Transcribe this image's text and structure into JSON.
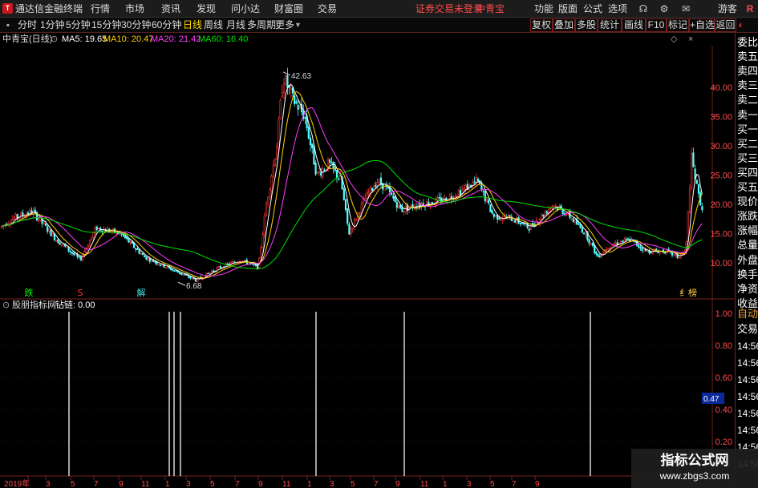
{
  "titlebar": {
    "app_title": "通达信金融终端",
    "menus": [
      "行情",
      "市场",
      "资讯",
      "发现",
      "问小达",
      "财富圈",
      "交易"
    ],
    "status_notice": "证券交易未登录",
    "stock_name": "中青宝",
    "right_menus": [
      "功能",
      "版面",
      "公式",
      "选项"
    ],
    "user": "游客"
  },
  "periodbar": {
    "periods": [
      "分时",
      "1分钟",
      "5分钟",
      "15分钟",
      "30分钟",
      "60分钟",
      "日线",
      "周线",
      "月线",
      "多周期",
      "更多"
    ],
    "active_period": "日线",
    "tools": [
      "复权",
      "叠加",
      "多股",
      "统计",
      "画线",
      "F10",
      "标记",
      "+自选",
      "返回"
    ]
  },
  "chart_info": {
    "title": "中青宝(日线)",
    "ma": [
      {
        "label": "MA5: 19.65",
        "color": "#ffffff"
      },
      {
        "label": "MA10: 20.47",
        "color": "#ffd200"
      },
      {
        "label": "MA20: 21.42",
        "color": "#ff3cff"
      },
      {
        "label": "MA60: 16.40",
        "color": "#00e000"
      }
    ]
  },
  "sidebar": {
    "items": [
      {
        "label": "委比",
        "color": "#ffffff"
      },
      {
        "label": "卖五",
        "color": "#ffffff"
      },
      {
        "label": "卖四",
        "color": "#ffffff"
      },
      {
        "label": "卖三",
        "color": "#ffffff"
      },
      {
        "label": "卖二",
        "color": "#ffffff"
      },
      {
        "label": "卖一",
        "color": "#ffffff"
      },
      {
        "label": "买一",
        "color": "#ffffff"
      },
      {
        "label": "买二",
        "color": "#ffffff"
      },
      {
        "label": "买三",
        "color": "#ffffff"
      },
      {
        "label": "买四",
        "color": "#ffffff"
      },
      {
        "label": "买五",
        "color": "#ffffff"
      },
      {
        "label": "现价",
        "color": "#ffffff"
      },
      {
        "label": "涨跌",
        "color": "#ffffff"
      },
      {
        "label": "涨幅",
        "color": "#ffffff"
      },
      {
        "label": "总量",
        "color": "#ffffff"
      },
      {
        "label": "外盘",
        "color": "#ffffff"
      },
      {
        "label": "换手",
        "color": "#ffffff"
      },
      {
        "label": "净资",
        "color": "#ffffff"
      },
      {
        "label": "收益",
        "color": "#ffffff"
      },
      {
        "label": "自动",
        "color": "#e8a040"
      },
      {
        "label": "交易",
        "color": "#ffffff"
      },
      {
        "label": "14:56",
        "color": "#ffffff"
      },
      {
        "label": "14:56",
        "color": "#ffffff"
      },
      {
        "label": "14:56",
        "color": "#ffffff"
      },
      {
        "label": "14:56",
        "color": "#ffffff"
      },
      {
        "label": "14:56",
        "color": "#ffffff"
      },
      {
        "label": "14:56",
        "color": "#ffffff"
      },
      {
        "label": "14:56",
        "color": "#ffffff"
      },
      {
        "label": "14:56",
        "color": "#ffffff"
      }
    ]
  },
  "main_chart": {
    "y_ticks": [
      "40.00",
      "35.00",
      "30.00",
      "25.00",
      "20.00",
      "15.00",
      "10.00"
    ],
    "high_label": "42.63",
    "low_label": "6.68",
    "markers": [
      {
        "text": "跌",
        "color": "#00ff00"
      },
      {
        "text": "S",
        "color": "#ff3030"
      },
      {
        "text": "解",
        "color": "#40e0e0"
      },
      {
        "text": "纟榜",
        "color": "#ffd040"
      }
    ]
  },
  "indicator": {
    "name": "股朋指标网",
    "value_label": "钻链: 0.00",
    "y_ticks": [
      "1.00",
      "0.80",
      "0.60",
      "0.40",
      "0.20"
    ],
    "current_value": "0.47"
  },
  "x_axis": {
    "labels": [
      "2019年",
      "3",
      "5",
      "7",
      "9",
      "11",
      "1",
      "3",
      "5",
      "7",
      "9",
      "11",
      "1",
      "3",
      "5",
      "7",
      "9",
      "11",
      "1",
      "3",
      "5",
      "7",
      "9"
    ]
  },
  "watermark": {
    "line1": "指标公式网",
    "line2": "www.zbgs3.com"
  },
  "colors": {
    "up": "#ff3232",
    "down": "#54ffff",
    "ma5": "#ffffff",
    "ma10": "#ffd200",
    "ma20": "#ff3cff",
    "ma60": "#00e000",
    "grid": "#7a1f1f",
    "axis_text": "#ff4a4a"
  }
}
